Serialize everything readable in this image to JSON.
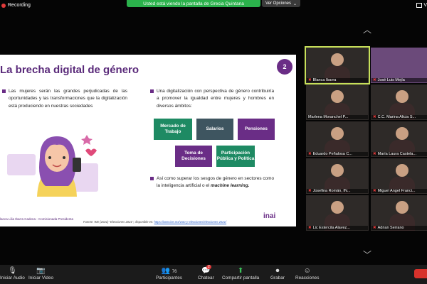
{
  "recording": {
    "label": "Recording"
  },
  "share_banner": {
    "text": "Usted está viendo la pantalla de Grecia Quintana"
  },
  "view_options": {
    "label": "Ver Opciones"
  },
  "window": {
    "partial_label": "V"
  },
  "slide": {
    "title": "La brecha digital de género",
    "number": "2",
    "left_text": "Las mujeres serán las grandes perjudicadas de las oportunidades y las transformaciones que la digitalización está produciendo en nuestras sociedades",
    "right_text": "Una digitalización con perspectiva de género contribuiría a promover la igualdad entre mujeres y hombres en diversos ámbitos:",
    "chips": [
      {
        "label": "Mercado de Trabajo",
        "color": "#1e8a63"
      },
      {
        "label": "Salarios",
        "color": "#3e5560"
      },
      {
        "label": "Pensiones",
        "color": "#6a2d86"
      },
      {
        "label": "Toma de Decisiones",
        "color": "#6a2d86"
      },
      {
        "label": "Participación Pública y Política",
        "color": "#1e8a63"
      }
    ],
    "bottom_text_a": "Así como superar los sesgos de género en sectores como la inteligencia artificial o el ",
    "bottom_text_b": "machine learning.",
    "footer_author": "lanca Lilia Ibarra Cadena - Comisionada Presidenta",
    "footer_source_a": "Fuente: WE (2021) \"Elecciones 2021\", disponible en: ",
    "footer_source_link": "https://www.ine.mx/voto-y-elecciones/elecciones-2021/",
    "logo": "inai"
  },
  "nav": {
    "up": "︿",
    "down": "﹀"
  },
  "participants": [
    {
      "name": "Blanca Ibarra",
      "muted": true,
      "active": true
    },
    {
      "name": "José Luis Mejía",
      "muted": true,
      "active": false
    },
    {
      "name": "Marlena Moranchel P...",
      "muted": false,
      "active": false
    },
    {
      "name": "C.C. Marina Alicia S...",
      "muted": true,
      "active": false
    },
    {
      "name": "Eduardo Peñalosa C...",
      "muted": true,
      "active": false
    },
    {
      "name": "María Laura Castela...",
      "muted": true,
      "active": false
    },
    {
      "name": "Josefina Román, IN...",
      "muted": true,
      "active": false
    },
    {
      "name": "Miguel Angel Franci...",
      "muted": true,
      "active": false
    },
    {
      "name": "Lic Estercita Alavez...",
      "muted": true,
      "active": false
    },
    {
      "name": "Adrian Serrano",
      "muted": true,
      "active": false
    }
  ],
  "toolbar": {
    "audio": "Iniciar Audio",
    "video": "Iniciar Video",
    "participants": "Participantes",
    "participants_count": "76",
    "chat": "Chatear",
    "chat_badge": "2",
    "share": "Compartir pantalla",
    "record": "Grabar",
    "reactions": "Reacciones"
  }
}
